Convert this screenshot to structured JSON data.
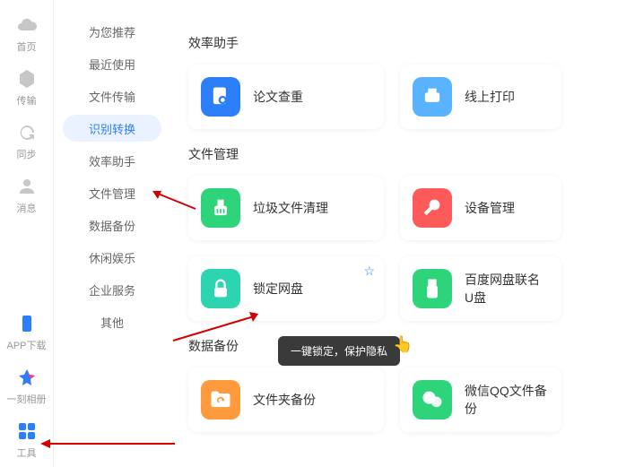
{
  "rail": {
    "items": [
      {
        "label": "首页",
        "icon": "cloud"
      },
      {
        "label": "传输",
        "icon": "hex"
      },
      {
        "label": "同步",
        "icon": "sync"
      },
      {
        "label": "消息",
        "icon": "person"
      }
    ],
    "bottom": [
      {
        "label": "APP下载",
        "icon": "phone"
      },
      {
        "label": "一刻相册",
        "icon": "album"
      },
      {
        "label": "工具",
        "icon": "grid"
      }
    ]
  },
  "side": {
    "items": [
      {
        "label": "为您推荐"
      },
      {
        "label": "最近使用"
      },
      {
        "label": "文件传输"
      },
      {
        "label": "识别转换",
        "active": true
      },
      {
        "label": "效率助手"
      },
      {
        "label": "文件管理"
      },
      {
        "label": "数据备份"
      },
      {
        "label": "休闲娱乐"
      },
      {
        "label": "企业服务"
      },
      {
        "label": "其他"
      }
    ]
  },
  "sections": {
    "s1": {
      "title": "效率助手",
      "cards": [
        {
          "label": "论文查重"
        },
        {
          "label": "线上打印"
        }
      ]
    },
    "s2": {
      "title": "文件管理",
      "cards": [
        {
          "label": "垃圾文件清理"
        },
        {
          "label": "设备管理"
        },
        {
          "label": "锁定网盘"
        },
        {
          "label": "百度网盘联名U盘"
        }
      ]
    },
    "s3": {
      "title": "数据备份",
      "cards": [
        {
          "label": "文件夹备份"
        },
        {
          "label": "微信QQ文件备份"
        }
      ]
    }
  },
  "tooltip": "一键锁定，保护隐私"
}
